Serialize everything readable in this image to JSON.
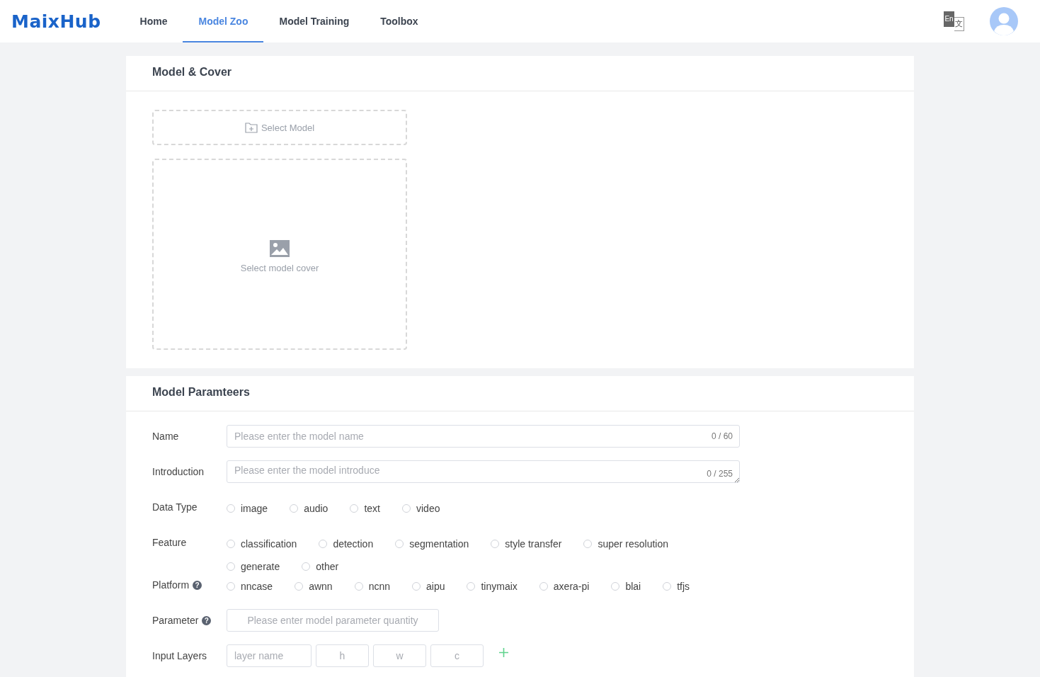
{
  "header": {
    "logo": "MaixHub",
    "nav": [
      {
        "label": "Home",
        "selected": false
      },
      {
        "label": "Model Zoo",
        "selected": true
      },
      {
        "label": "Model Training",
        "selected": false
      },
      {
        "label": "Toolbox",
        "selected": false
      }
    ],
    "language": {
      "en": "En",
      "zh": "文"
    }
  },
  "model_cover": {
    "title": "Model & Cover",
    "select_model": "Select Model",
    "select_cover": "Select model cover"
  },
  "parameters": {
    "title": "Model Paramteers",
    "name": {
      "label": "Name",
      "placeholder": "Please enter the model name",
      "counter": "0 / 60"
    },
    "introduction": {
      "label": "Introduction",
      "placeholder": "Please enter the model introduce",
      "counter": "0 / 255"
    },
    "radio_groups": [
      {
        "label": "Data Type",
        "help": false,
        "options": [
          {
            "label": "image",
            "selected": false
          },
          {
            "label": "audio",
            "selected": false
          },
          {
            "label": "text",
            "selected": false
          },
          {
            "label": "video",
            "selected": false
          }
        ]
      },
      {
        "label": "Feature",
        "help": false,
        "options": [
          {
            "label": "classification",
            "selected": false
          },
          {
            "label": "detection",
            "selected": false
          },
          {
            "label": "segmentation",
            "selected": false
          },
          {
            "label": "style transfer",
            "selected": false
          },
          {
            "label": "super resolution",
            "selected": false
          },
          {
            "label": "generate",
            "selected": false
          },
          {
            "label": "other",
            "selected": false
          }
        ]
      },
      {
        "label": "Platform",
        "help": true,
        "options": [
          {
            "label": "nncase",
            "selected": false
          },
          {
            "label": "awnn",
            "selected": false
          },
          {
            "label": "ncnn",
            "selected": false
          },
          {
            "label": "aipu",
            "selected": false
          },
          {
            "label": "tinymaix",
            "selected": false
          },
          {
            "label": "axera-pi",
            "selected": false
          },
          {
            "label": "blai",
            "selected": false
          },
          {
            "label": "tfjs",
            "selected": false
          }
        ]
      }
    ],
    "help_mark": "?",
    "parameter": {
      "label": "Parameter",
      "help": true,
      "placeholder": "Please enter model parameter quantity"
    },
    "input_layers": {
      "label": "Input Layers",
      "placeholders": [
        "layer name",
        "h",
        "w",
        "c"
      ]
    }
  }
}
